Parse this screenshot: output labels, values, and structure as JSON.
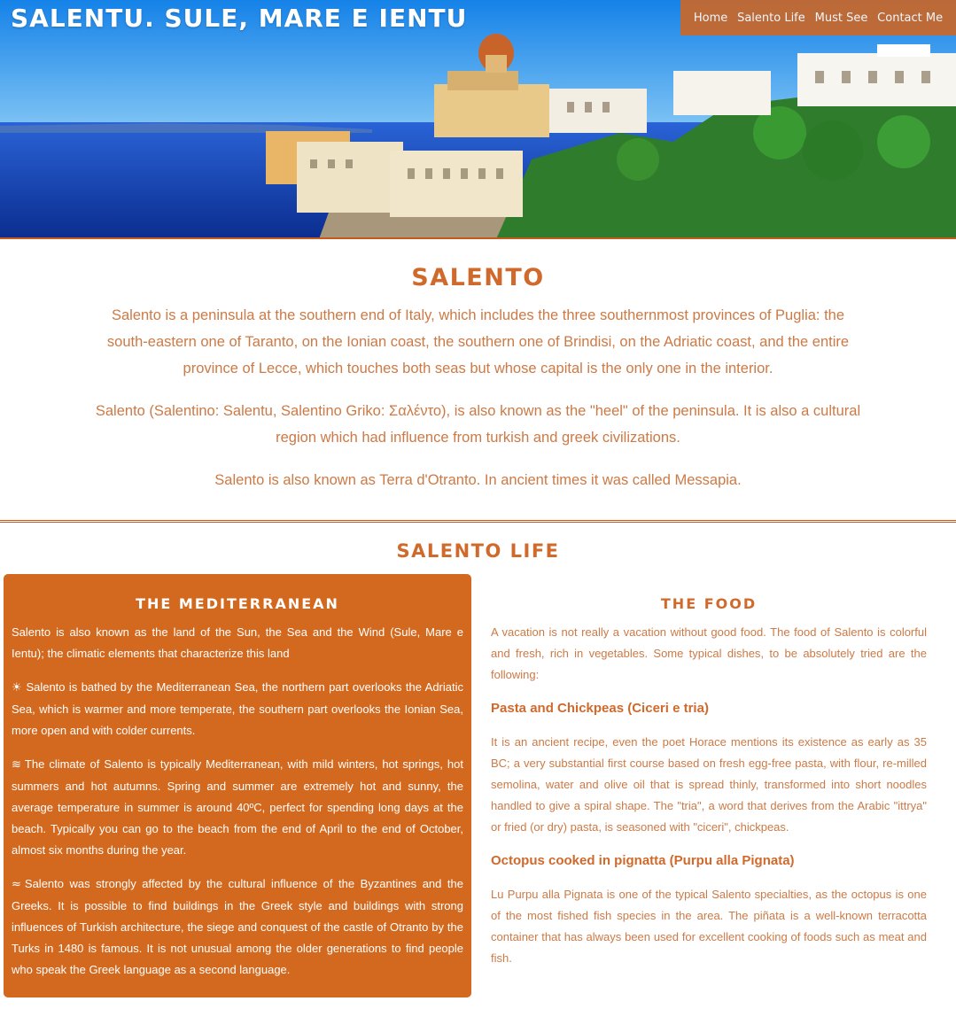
{
  "header": {
    "site_title": "SALENTU. SULE, MARE E IENTU",
    "nav": [
      "Home",
      "Salento Life",
      "Must See",
      "Contact Me"
    ]
  },
  "intro": {
    "title": "SALENTO",
    "paragraphs": [
      "Salento is a peninsula at the southern end of Italy, which includes the three southernmost provinces of Puglia: the south-eastern one of Taranto, on the Ionian coast, the southern one of Brindisi, on the Adriatic coast, and the entire province of Lecce, which touches both seas but whose capital is the only one in the interior.",
      "Salento (Salentino: Salentu, Salentino Griko: Σαλέντο), is also known as the \"heel\" of the peninsula. It is also a cultural region which had influence from turkish and greek civilizations.",
      "Salento is also known as Terra d'Otranto. In ancient times it was called Messapia."
    ]
  },
  "life": {
    "title": "SALENTO LIFE",
    "mediterranean": {
      "title": "THE MEDITERRANEAN",
      "intro": "Salento is also known as the land of the Sun, the Sea and the Wind (Sule, Mare e Ientu); the climatic elements that characterize this land",
      "items": [
        {
          "icon": "sun-icon",
          "glyph": "☀",
          "text": "Salento is bathed by the Mediterranean Sea, the northern part overlooks the Adriatic Sea, which is warmer and more temperate, the southern part overlooks the Ionian Sea, more open and with colder currents."
        },
        {
          "icon": "water-icon",
          "glyph": "≋",
          "text": "The climate of Salento is typically Mediterranean, with mild winters, hot springs, hot summers and hot autumns. Spring and summer are extremely hot and sunny, the average temperature in summer is around 40ºC, perfect for spending long days at the beach. Typically you can go to the beach from the end of April to the end of October, almost six months during the year."
        },
        {
          "icon": "wind-icon",
          "glyph": "≈",
          "text": "Salento was strongly affected by the cultural influence of the Byzantines and the Greeks. It is possible to find buildings in the Greek style and buildings with strong influences of Turkish architecture, the siege and conquest of the castle of Otranto by the Turks in 1480 is famous. It is not unusual among the older generations to find people who speak the Greek language as a second language."
        }
      ]
    },
    "food": {
      "title": "THE FOOD",
      "intro": "A vacation is not really a vacation without good food. The food of Salento is colorful and fresh, rich in vegetables. Some typical dishes, to be absolutely tried are the following:",
      "dishes": [
        {
          "name": "Pasta and Chickpeas (Ciceri e tria)",
          "text": "It is an ancient recipe, even the poet Horace mentions its existence as early as 35 BC; a very substantial first course based on fresh egg-free pasta, with flour, re-milled semolina, water and olive oil that is spread thinly, transformed into short noodles handled to give a spiral shape. The \"tria\", a word that derives from the Arabic \"ittrya\" or fried (or dry) pasta, is seasoned with \"ciceri\", chickpeas."
        },
        {
          "name": "Octopus cooked in pignatta (Purpu alla Pignata)",
          "text": "Lu Purpu alla Pignata is one of the typical Salento specialties, as the octopus is one of the most fished fish species in the area. The piñata is a well-known terracotta container that has always been used for excellent cooking of foods such as meat and fish."
        }
      ]
    }
  },
  "colors": {
    "accent": "#cf6a2c",
    "card": "#d3691f",
    "nav": "#c8682b",
    "text": "#cc7a46"
  }
}
